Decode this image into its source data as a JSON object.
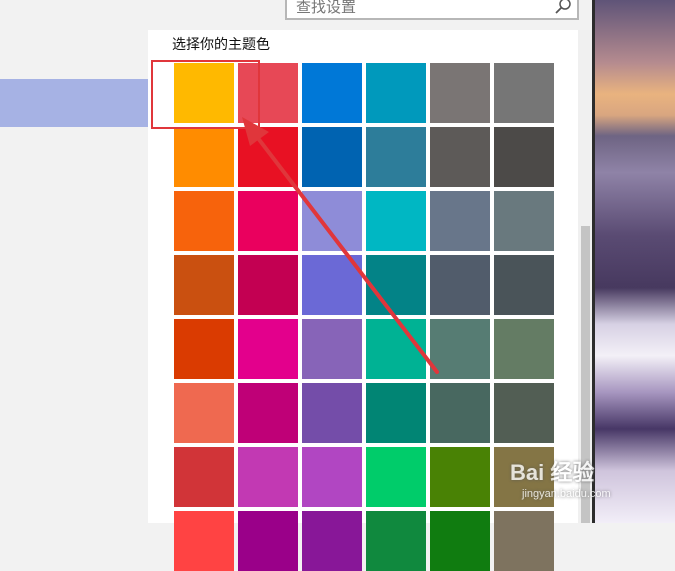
{
  "search": {
    "placeholder": "查找设置"
  },
  "section_title": "选择你的主题色",
  "swatches": [
    [
      "#ffb900",
      "#e74856",
      "#0078d7",
      "#0099bc",
      "#7a7574",
      "#767676"
    ],
    [
      "#ff8c00",
      "#e81123",
      "#0063b1",
      "#2d7d9a",
      "#5d5a58",
      "#4c4a48"
    ],
    [
      "#f7630c",
      "#ea005e",
      "#8e8cd8",
      "#00b7c3",
      "#68768a",
      "#69797e"
    ],
    [
      "#ca5010",
      "#c30052",
      "#6b69d6",
      "#038387",
      "#515c6b",
      "#4a5459"
    ],
    [
      "#da3b01",
      "#e3008c",
      "#8764b8",
      "#00b294",
      "#567c73",
      "#647c64"
    ],
    [
      "#ef6950",
      "#bf0077",
      "#744da9",
      "#018574",
      "#486860",
      "#525e54"
    ],
    [
      "#d13438",
      "#c239b3",
      "#b146c2",
      "#00cc6a",
      "#498205",
      "#847545"
    ],
    [
      "#ff4343",
      "#9a0089",
      "#881798",
      "#10893e",
      "#107c10",
      "#7e735f"
    ]
  ],
  "selected_swatch": {
    "row": 0,
    "col": 0
  },
  "annotation_color": "#e0363b",
  "watermark": {
    "logo": "Bai 经验",
    "url": "jingyan.baidu.com"
  },
  "icons": {
    "search": "search-icon"
  }
}
